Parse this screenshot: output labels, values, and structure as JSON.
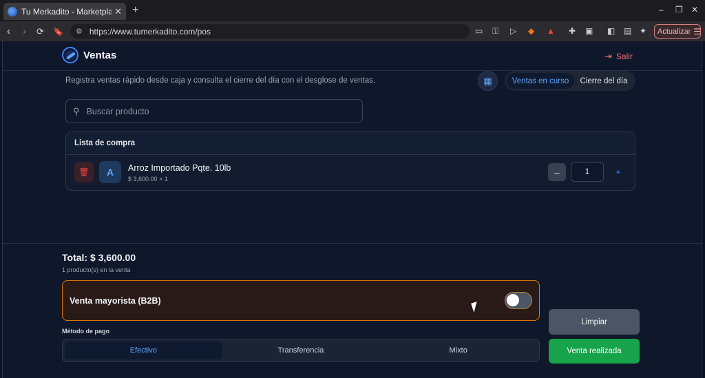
{
  "browser": {
    "tab_title": "Tu Merkadito - Marketplac",
    "tab_close": "✕",
    "new_tab": "+",
    "url": "https://www.tumerkadito.com/pos",
    "update_label": "Actualizar",
    "window_controls": [
      "–",
      "❐",
      "✕"
    ]
  },
  "header": {
    "title": "Ventas",
    "logout_label": "Salir"
  },
  "subtitle": "Registra ventas rápido desde caja y consulta el cierre del día con el desglose de ventas.",
  "view_tabs": {
    "active": "Ventas en curso",
    "inactive": "Cierre del día"
  },
  "search": {
    "placeholder": "Buscar producto",
    "value": ""
  },
  "cart": {
    "heading": "Lista de compra",
    "items": [
      {
        "initial": "A",
        "name": "Arroz Importado Pqte. 10lb",
        "price_line": "$ 3,600.00 × 1",
        "quantity": "1",
        "minus": "–",
        "plus": "+"
      }
    ]
  },
  "summary": {
    "total": "Total: $ 3,600.00",
    "count": "1 producto(s) en la venta"
  },
  "wholesale": {
    "label": "Venta mayorista (B2B)",
    "enabled": false
  },
  "payment": {
    "label": "Método de pago",
    "options": [
      "Efectivo",
      "Transferencia",
      "Mixto"
    ],
    "selected": "Efectivo"
  },
  "actions": {
    "clear": "Limpiar",
    "done": "Venta realizada"
  },
  "colors": {
    "accent": "#3b82f6",
    "success": "#16a34a",
    "danger": "#ef4444",
    "warning_border": "#d97706"
  }
}
